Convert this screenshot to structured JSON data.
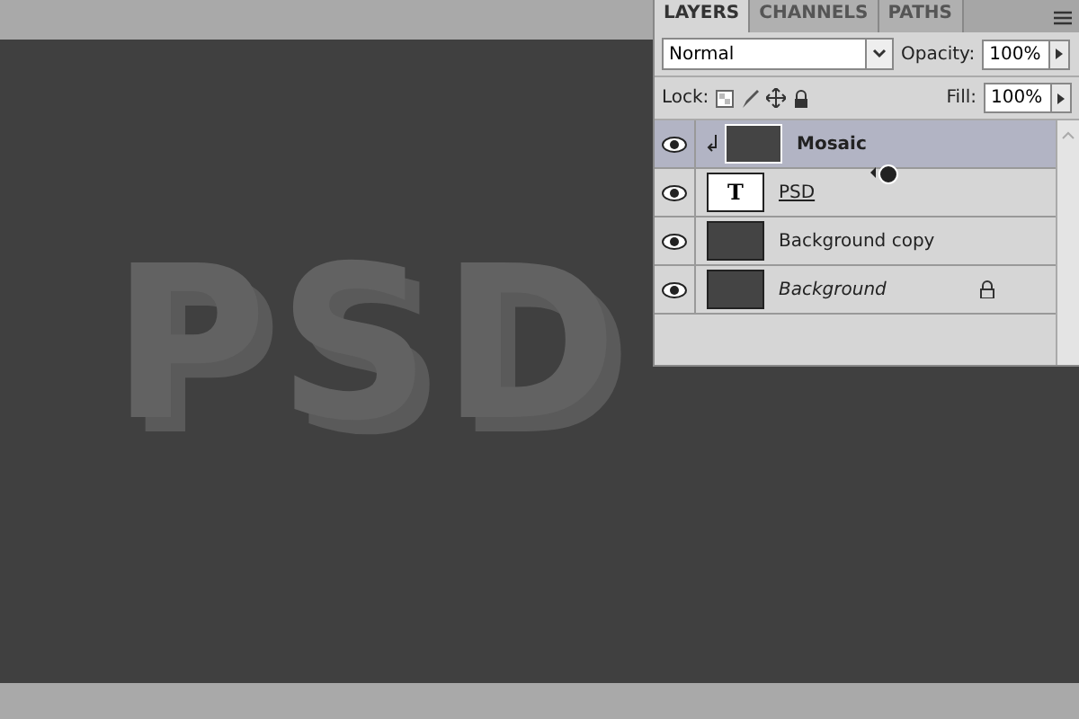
{
  "canvas": {
    "text": "PSD"
  },
  "layers_panel": {
    "tabs": [
      {
        "label": "LAYERS",
        "selected": true
      },
      {
        "label": "CHANNELS",
        "selected": false
      },
      {
        "label": "PATHS",
        "selected": false
      }
    ],
    "blend_mode": "Normal",
    "opacity_label": "Opacity:",
    "opacity_value": "100%",
    "lock_label": "Lock:",
    "fill_label": "Fill:",
    "fill_value": "100%",
    "layers": [
      {
        "name": "Mosaic",
        "kind": "pixel",
        "selected": true,
        "visible": true,
        "clipped": true,
        "clip_base": false,
        "locked": false
      },
      {
        "name": "PSD",
        "kind": "text",
        "thumb_glyph": "T",
        "selected": false,
        "visible": true,
        "clipped": false,
        "clip_base": true,
        "locked": false
      },
      {
        "name": "Background copy",
        "kind": "pixel",
        "selected": false,
        "visible": true,
        "clipped": false,
        "clip_base": false,
        "locked": false
      },
      {
        "name": "Background",
        "kind": "pixel",
        "selected": false,
        "visible": true,
        "clipped": false,
        "clip_base": false,
        "locked": true
      }
    ]
  }
}
